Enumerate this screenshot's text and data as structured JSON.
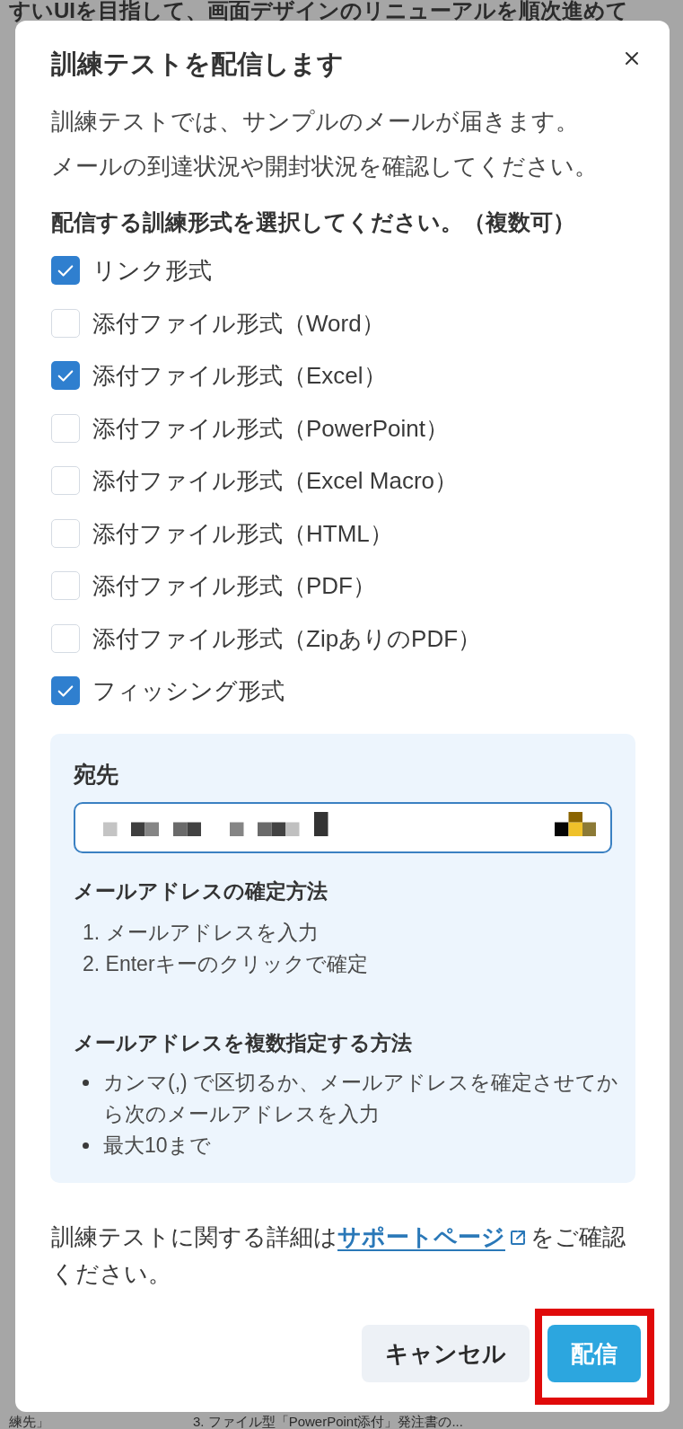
{
  "background_page": {
    "banner_text": "すいUIを目指して、画面デザインのリニューアルを順次進めて",
    "bottom_row": [
      "練先」",
      "3. ファイル型「PowerPoint添付」発注書の..."
    ]
  },
  "dialog": {
    "title": "訓練テストを配信します",
    "description": [
      "訓練テストでは、サンプルのメールが届きます。",
      "メールの到達状況や開封状況を確認してください。"
    ],
    "format_question": "配信する訓練形式を選択してください。（複数可）",
    "formats": [
      {
        "label": "リンク形式",
        "checked": true
      },
      {
        "label": "添付ファイル形式（Word）",
        "checked": false
      },
      {
        "label": "添付ファイル形式（Excel）",
        "checked": true
      },
      {
        "label": "添付ファイル形式（PowerPoint）",
        "checked": false
      },
      {
        "label": "添付ファイル形式（Excel Macro）",
        "checked": false
      },
      {
        "label": "添付ファイル形式（HTML）",
        "checked": false
      },
      {
        "label": "添付ファイル形式（PDF）",
        "checked": false
      },
      {
        "label": "添付ファイル形式（ZipありのPDF）",
        "checked": false
      },
      {
        "label": "フィッシング形式",
        "checked": true
      }
    ],
    "recipient_panel": {
      "label": "宛先",
      "field": {
        "focused": true,
        "redacted": true
      },
      "confirm_heading": "メールアドレスの確定方法",
      "confirm_steps": [
        "1. メールアドレスを入力",
        "2. Enterキーのクリックで確定"
      ],
      "multiple_heading": "メールアドレスを複数指定する方法",
      "multiple_tips": [
        "カンマ(,) で区切るか、メールアドレスを確定させてから次のメールアドレスを入力",
        "最大10まで"
      ]
    },
    "support_note": {
      "before": "訓練テストに関する詳細は",
      "link": "サポートページ",
      "after": "をご確認ください。"
    },
    "buttons": [
      {
        "label": "キャンセル",
        "kind": "secondary",
        "highlighted": false
      },
      {
        "label": "配信",
        "kind": "primary",
        "highlighted": true
      }
    ]
  }
}
